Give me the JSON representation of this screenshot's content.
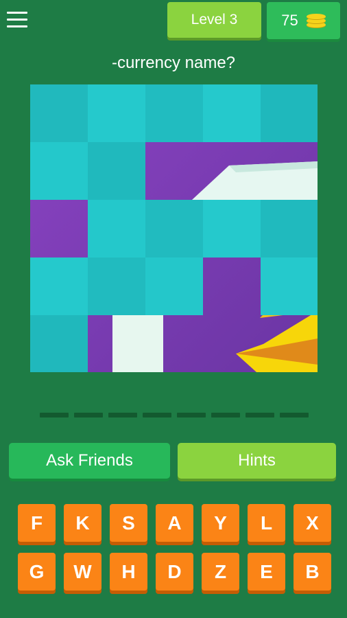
{
  "header": {
    "menu_icon": "hamburger-menu-icon",
    "level_label": "Level 3",
    "coins": "75",
    "coins_icon": "gold-coins-icon"
  },
  "question": "-currency name?",
  "puzzle": {
    "hidden_image_icon": "partially-revealed-image",
    "colors": {
      "tile": "#22c6c9",
      "tile_dark": "#1db7bb",
      "image_purple": "#7b3fb0",
      "image_yellow": "#f7d60a"
    }
  },
  "answer": {
    "slot_count": 8
  },
  "actions": {
    "ask_friends_label": "Ask Friends",
    "hints_label": "Hints"
  },
  "keyboard": {
    "row1": [
      "F",
      "K",
      "S",
      "A",
      "Y",
      "L",
      "X"
    ],
    "row2": [
      "G",
      "W",
      "H",
      "D",
      "Z",
      "E",
      "B"
    ]
  },
  "colors": {
    "background": "#1e7c45",
    "key": "#fb8416",
    "accent_green": "#8bd33f"
  }
}
